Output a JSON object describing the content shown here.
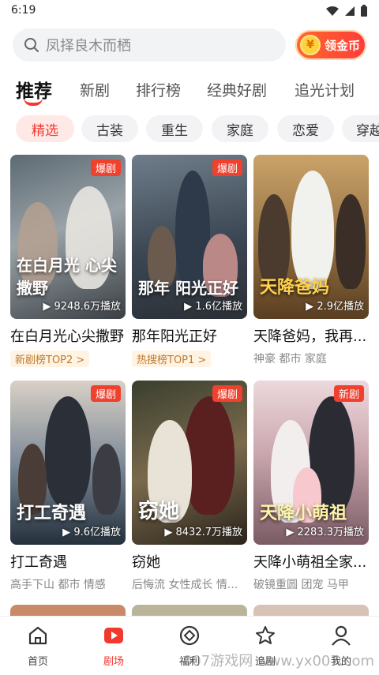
{
  "status": {
    "time": "6:19"
  },
  "search": {
    "placeholder": "凤择良木而栖"
  },
  "coin_button": {
    "label": "领金币",
    "coin_glyph": "¥"
  },
  "tabs": [
    {
      "label": "推荐",
      "active": true
    },
    {
      "label": "新剧"
    },
    {
      "label": "排行榜"
    },
    {
      "label": "经典好剧"
    },
    {
      "label": "追光计划"
    }
  ],
  "chips": [
    {
      "label": "精选",
      "active": true
    },
    {
      "label": "古装"
    },
    {
      "label": "重生"
    },
    {
      "label": "家庭"
    },
    {
      "label": "恋爱"
    },
    {
      "label": "穿越"
    }
  ],
  "dramas": [
    {
      "title": "在白月光心尖撒野",
      "badge": "爆剧",
      "plays": "9248.6万播放",
      "overlay": "在白月光 心尖撒野",
      "rank": "新剧榜TOP2 >",
      "tags": ""
    },
    {
      "title": "那年阳光正好",
      "badge": "爆剧",
      "plays": "1.6亿播放",
      "overlay": "那年 阳光正好",
      "rank": "热搜榜TOP1 >",
      "tags": ""
    },
    {
      "title": "天降爸妈，我再...",
      "badge": "",
      "plays": "2.9亿播放",
      "overlay": "天降爸妈",
      "rank": "",
      "tags": "神豪 都市 家庭"
    },
    {
      "title": "打工奇遇",
      "badge": "爆剧",
      "plays": "9.6亿播放",
      "overlay": "打工奇遇",
      "rank": "",
      "tags": "高手下山 都市 情感"
    },
    {
      "title": "窃她",
      "badge": "爆剧",
      "plays": "8432.7万播放",
      "overlay": "窃她",
      "rank": "",
      "tags": "后悔流 女性成长 情..."
    },
    {
      "title": "天降小萌祖全家...",
      "badge": "新剧",
      "plays": "2283.3万播放",
      "overlay": "天降小萌祖",
      "rank": "",
      "tags": "破镜重圆 团宠 马甲"
    }
  ],
  "bottom_nav": [
    {
      "label": "首页",
      "icon": "home-icon"
    },
    {
      "label": "剧场",
      "icon": "theater-icon",
      "active": true
    },
    {
      "label": "福利",
      "icon": "benefit-icon"
    },
    {
      "label": "追剧",
      "icon": "follow-icon"
    },
    {
      "label": "我的",
      "icon": "profile-icon"
    }
  ],
  "watermark": "007游戏网 www.yx007.com",
  "colors": {
    "accent": "#f03a2e",
    "chip_active_bg": "#ffe9e6",
    "badge": "#f0402e",
    "rank_text": "#c07a2a"
  }
}
